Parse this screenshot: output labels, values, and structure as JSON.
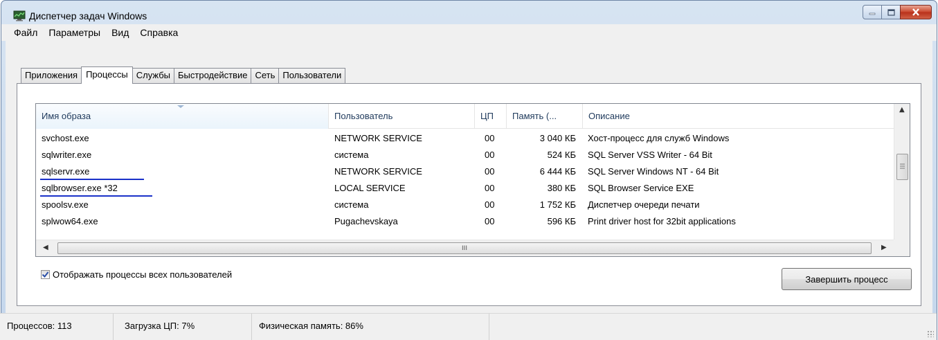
{
  "window": {
    "title": "Диспетчер задач Windows"
  },
  "menu": [
    "Файл",
    "Параметры",
    "Вид",
    "Справка"
  ],
  "tabs": [
    "Приложения",
    "Процессы",
    "Службы",
    "Быстродействие",
    "Сеть",
    "Пользователи"
  ],
  "active_tab": "Процессы",
  "columns": [
    "Имя образа",
    "Пользователь",
    "ЦП",
    "Память (...",
    "Описание"
  ],
  "rows": [
    {
      "name": "svchost.exe",
      "user": "NETWORK SERVICE",
      "cpu": "00",
      "mem": "3 040 КБ",
      "desc": "Хост-процесс для служб Windows",
      "highlighted": false
    },
    {
      "name": "sqlwriter.exe",
      "user": "система",
      "cpu": "00",
      "mem": "524 КБ",
      "desc": "SQL Server VSS Writer - 64 Bit",
      "highlighted": false
    },
    {
      "name": "sqlservr.exe",
      "user": "NETWORK SERVICE",
      "cpu": "00",
      "mem": "6 444 КБ",
      "desc": "SQL Server Windows NT - 64 Bit",
      "highlighted": true
    },
    {
      "name": "sqlbrowser.exe *32",
      "user": "LOCAL SERVICE",
      "cpu": "00",
      "mem": "380 КБ",
      "desc": "SQL Browser Service EXE",
      "highlighted": true
    },
    {
      "name": "spoolsv.exe",
      "user": "система",
      "cpu": "00",
      "mem": "1 752 КБ",
      "desc": "Диспетчер очереди печати",
      "highlighted": false
    },
    {
      "name": "splwow64.exe",
      "user": "Pugachevskaya",
      "cpu": "00",
      "mem": "596 КБ",
      "desc": "Print driver host for 32bit applications",
      "highlighted": false
    }
  ],
  "hscroll_grip": "III",
  "show_all_checkbox": {
    "label": "Отображать процессы всех пользователей",
    "checked": true
  },
  "end_process_button": "Завершить процесс",
  "status": {
    "processes": "Процессов: 113",
    "cpu": "Загрузка ЦП: 7%",
    "memory": "Физическая память: 86%"
  },
  "colors": {
    "underline": "#1a31c9",
    "close_button": "#c9462c"
  }
}
